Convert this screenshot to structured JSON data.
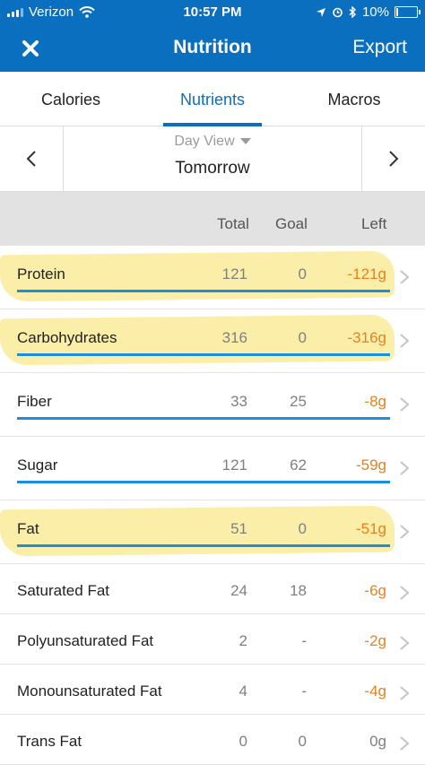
{
  "status_bar": {
    "carrier": "Verizon",
    "time": "10:57 PM",
    "battery": "10%",
    "battery_level": 0.1
  },
  "nav": {
    "title": "Nutrition",
    "export_label": "Export",
    "close_icon": "close-icon"
  },
  "tabs": [
    {
      "label": "Calories",
      "active": false
    },
    {
      "label": "Nutrients",
      "active": true
    },
    {
      "label": "Macros",
      "active": false
    }
  ],
  "day_picker": {
    "view_label": "Day View",
    "date": "Tomorrow"
  },
  "columns": {
    "total": "Total",
    "goal": "Goal",
    "left": "Left"
  },
  "colors": {
    "brand_blue": "#0b6fc0",
    "progress_blue": "#1a8ee0",
    "over_orange": "#e6811d",
    "highlight": "#fbeca0"
  },
  "nutrients": [
    {
      "name": "Protein",
      "total": "121",
      "goal": "0",
      "left": "-121g",
      "highlighted": true,
      "has_bar": true
    },
    {
      "name": "Carbohydrates",
      "total": "316",
      "goal": "0",
      "left": "-316g",
      "highlighted": true,
      "has_bar": true
    },
    {
      "name": "Fiber",
      "total": "33",
      "goal": "25",
      "left": "-8g",
      "highlighted": false,
      "has_bar": true
    },
    {
      "name": "Sugar",
      "total": "121",
      "goal": "62",
      "left": "-59g",
      "highlighted": false,
      "has_bar": true
    },
    {
      "name": "Fat",
      "total": "51",
      "goal": "0",
      "left": "-51g",
      "highlighted": true,
      "has_bar": true
    },
    {
      "name": "Saturated Fat",
      "total": "24",
      "goal": "18",
      "left": "-6g",
      "highlighted": false,
      "has_bar": false
    },
    {
      "name": "Polyunsaturated Fat",
      "total": "2",
      "goal": "-",
      "left": "-2g",
      "highlighted": false,
      "has_bar": false
    },
    {
      "name": "Monounsaturated Fat",
      "total": "4",
      "goal": "-",
      "left": "-4g",
      "highlighted": false,
      "has_bar": false
    },
    {
      "name": "Trans Fat",
      "total": "0",
      "goal": "0",
      "left": "0g",
      "highlighted": false,
      "has_bar": false
    }
  ]
}
